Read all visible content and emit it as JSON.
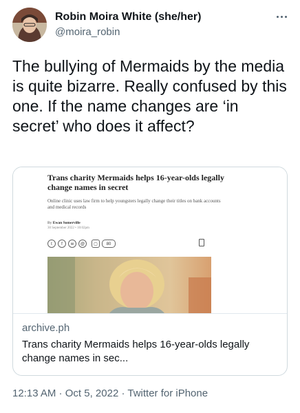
{
  "author": {
    "display_name": "Robin Moira White (she/her)",
    "handle": "@moira_robin"
  },
  "tweet": {
    "text": "The bullying of Mermaids by the media is quite bizarre.  Really confused by this one.  If the name changes are ‘in secret’ who does it affect?"
  },
  "article_screenshot": {
    "headline": "Trans charity Mermaids helps 16-year-olds legally change names in secret",
    "subheadline": "Online clinic uses law firm to help youngsters legally change their titles on bank accounts and medical records",
    "byline_prefix": "By",
    "byline_name": "Ewan Somerville",
    "date": "30 September 2022 • 10:02pm",
    "comment_count": "80"
  },
  "link_card": {
    "domain": "archive.ph",
    "title": "Trans charity Mermaids helps 16-year-olds legally change names in sec..."
  },
  "meta": {
    "time": "12:13 AM",
    "separator": " · ",
    "date": "Oct 5, 2022",
    "source": "Twitter for iPhone"
  },
  "icons": [
    "more-options-icon",
    "twitter-share-icon",
    "facebook-share-icon",
    "whatsapp-share-icon",
    "email-share-icon",
    "gift-icon",
    "comment-icon",
    "bookmark-icon"
  ]
}
